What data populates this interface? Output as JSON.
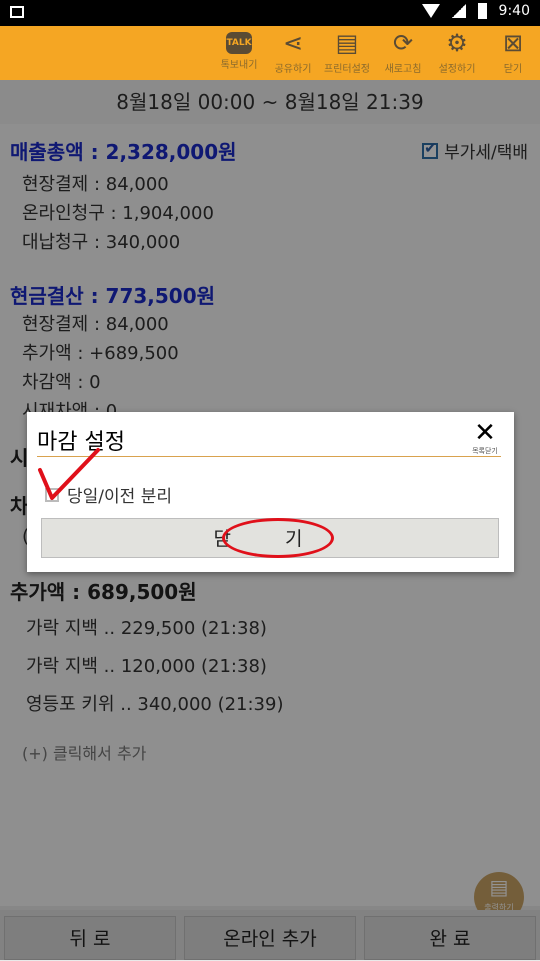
{
  "status_bar": {
    "time": "9:40"
  },
  "toolbar": {
    "items": [
      {
        "label": "톡보내기",
        "icon": "talk-icon",
        "glyph": "TALK"
      },
      {
        "label": "공유하기",
        "icon": "share-icon",
        "glyph": "⋖"
      },
      {
        "label": "프린터설정",
        "icon": "printer-icon",
        "glyph": "▤"
      },
      {
        "label": "새로고침",
        "icon": "refresh-icon",
        "glyph": "⟳"
      },
      {
        "label": "설정하기",
        "icon": "gear-icon",
        "glyph": "⚙"
      },
      {
        "label": "닫기",
        "icon": "close-window-icon",
        "glyph": "⊠"
      }
    ]
  },
  "date_range": "8월18일 00:00 ~ 8월18일 21:39",
  "sales": {
    "title": "매출총액 : 2,328,000원",
    "vat_label": "부가세/택배",
    "vat_checked": true,
    "items": [
      "현장결제 : 84,000",
      "온라인청구 : 1,904,000",
      "대납청구 : 340,000"
    ]
  },
  "cash": {
    "title": "현금결산 : 773,500원",
    "items": [
      "현장결제 : 84,000",
      "추가액 : +689,500",
      "차감액 : 0",
      "시재차액 : 0"
    ]
  },
  "hidden_rows": [
    "시",
    "차",
    "("
  ],
  "added": {
    "title": "추가액 : 689,500원",
    "entries": [
      "가락 지백 .. 229,500 (21:38)",
      "가락 지백 .. 120,000 (21:38)",
      "영등포 키위 .. 340,000 (21:39)"
    ],
    "add_label": "(+) 클릭해서 추가"
  },
  "print_fab_label": "출력하기",
  "bottom": {
    "back": "뒤 로",
    "online_add": "온라인 추가",
    "done": "완 료"
  },
  "dialog": {
    "title": "마감 설정",
    "close_label": "목록닫기",
    "option_label": "당일/이전 분리",
    "option_checked": false,
    "close_button": "닫 기"
  },
  "colors": {
    "toolbar": "#f5a623",
    "accent_blue": "#1a2ac7",
    "annotation_red": "#e0101a"
  }
}
